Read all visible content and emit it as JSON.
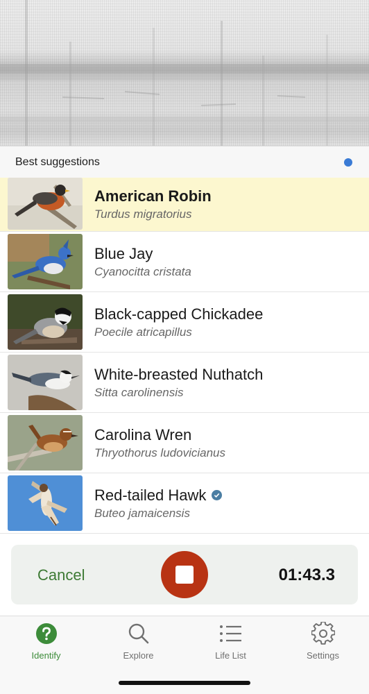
{
  "suggestions_header": {
    "title": "Best suggestions"
  },
  "birds": [
    {
      "common": "American Robin",
      "scientific": "Turdus migratorius",
      "highlighted": true,
      "verified": false
    },
    {
      "common": "Blue Jay",
      "scientific": "Cyanocitta cristata",
      "highlighted": false,
      "verified": false
    },
    {
      "common": "Black-capped Chickadee",
      "scientific": "Poecile atricapillus",
      "highlighted": false,
      "verified": false
    },
    {
      "common": "White-breasted Nuthatch",
      "scientific": "Sitta carolinensis",
      "highlighted": false,
      "verified": false
    },
    {
      "common": "Carolina Wren",
      "scientific": "Thryothorus ludovicianus",
      "highlighted": false,
      "verified": false
    },
    {
      "common": "Red-tailed Hawk",
      "scientific": "Buteo jamaicensis",
      "highlighted": false,
      "verified": true
    }
  ],
  "recording": {
    "cancel_label": "Cancel",
    "timer": "01:43.3"
  },
  "tabs": [
    {
      "label": "Identify",
      "icon": "question-circle-icon",
      "active": true
    },
    {
      "label": "Explore",
      "icon": "search-icon",
      "active": false
    },
    {
      "label": "Life List",
      "icon": "list-icon",
      "active": false
    },
    {
      "label": "Settings",
      "icon": "gear-icon",
      "active": false
    }
  ],
  "colors": {
    "highlight_row": "#fcf7cf",
    "stop_button": "#b83313",
    "accent_green": "#3d8c3a",
    "status_dot": "#3a7bd5",
    "verified_badge": "#4b7ea3"
  }
}
